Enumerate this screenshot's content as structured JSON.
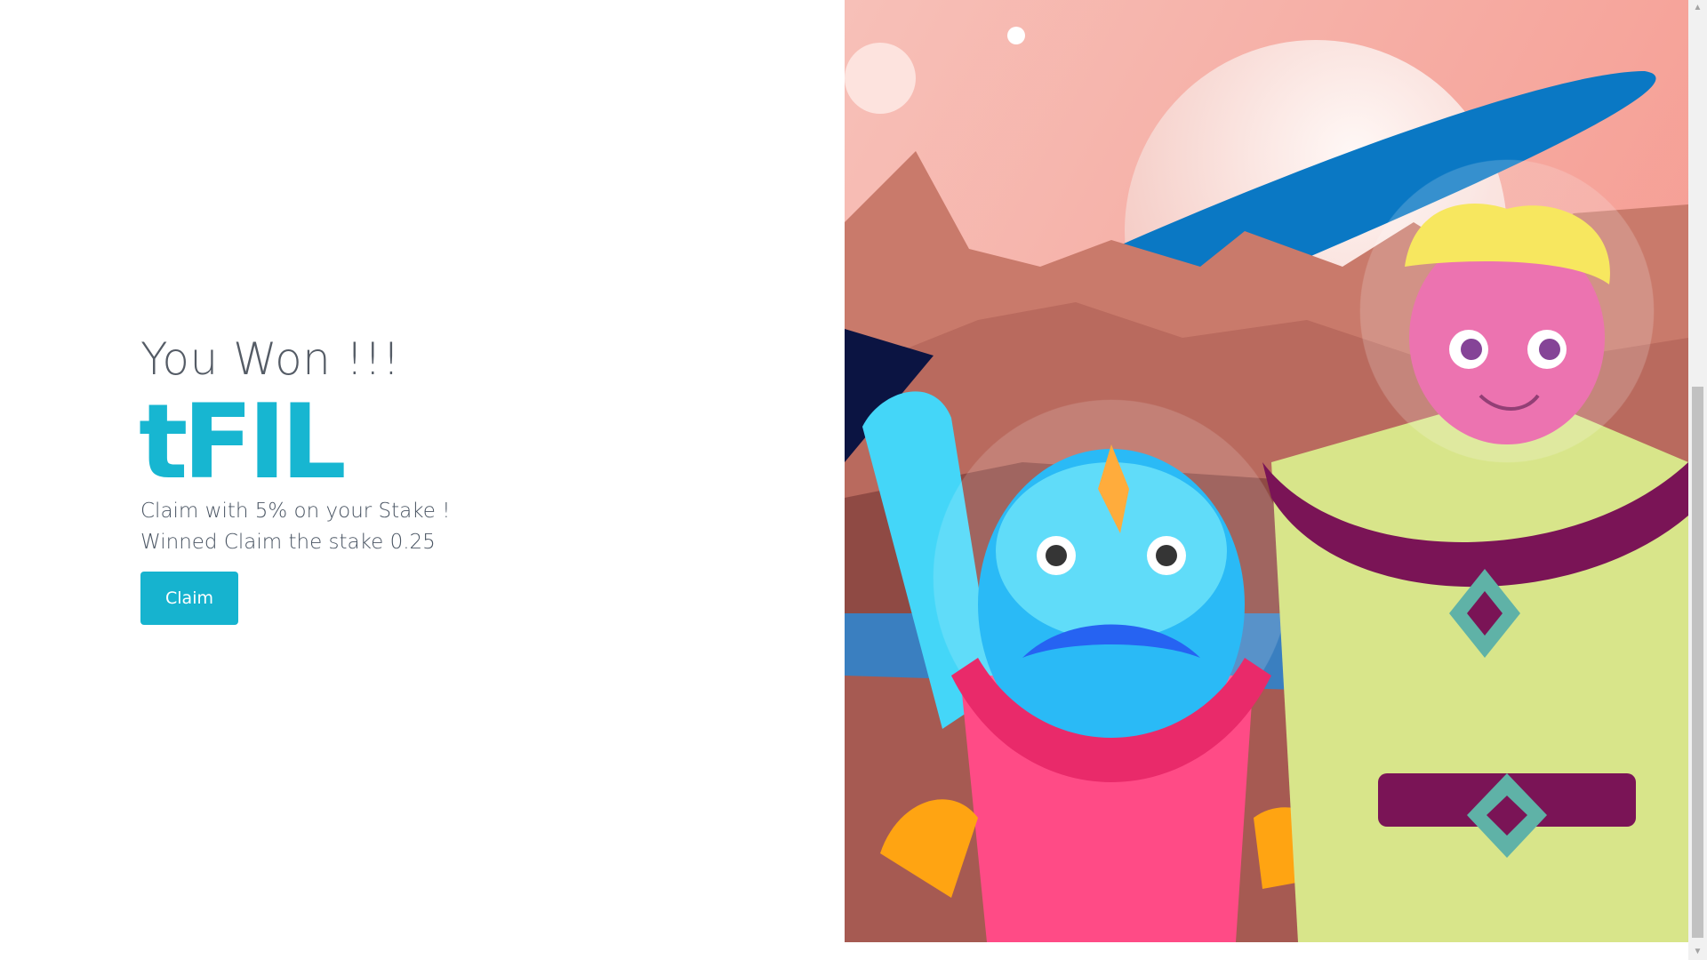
{
  "result": {
    "title": "You Won !!!",
    "token": "tFIL",
    "line1": "Claim with 5% on your Stake !",
    "line2": "Winned Claim the stake 0.25",
    "button_label": "Claim"
  },
  "colors": {
    "accent": "#17b6d1",
    "text": "#4a5563"
  },
  "illustration": {
    "icon": "space-aliens-illustration"
  }
}
